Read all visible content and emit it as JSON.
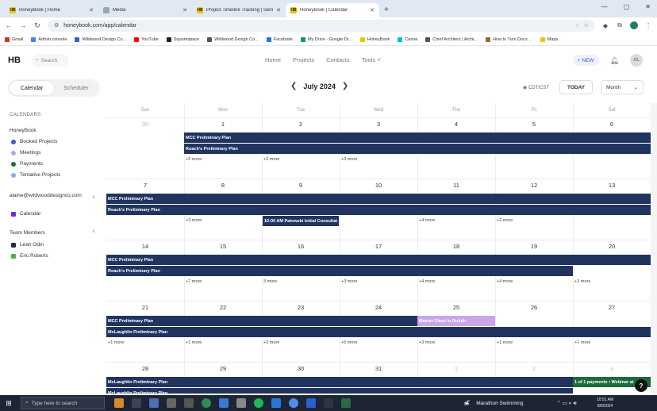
{
  "browser": {
    "tabs": [
      {
        "label": "HoneyBook | Home",
        "favicon": "HB"
      },
      {
        "label": "Media",
        "favicon": "media"
      },
      {
        "label": "Project Timeline Tracking | Semrau",
        "favicon": "HB"
      },
      {
        "label": "HoneyBook | Calendar",
        "favicon": "HB",
        "active": true
      }
    ],
    "url": "honeybook.com/app/calendar",
    "bookmarks": [
      "Gmail",
      "Admin console",
      "Wildwood Design Co...",
      "YouTube",
      "Squarespace",
      "Wildwood Design Co...",
      "Facebook",
      "My Drive - Google Dr...",
      "HoneyBook",
      "Canva",
      "Chief Architect | Archi...",
      "How to Turn Docs ...",
      "Maps"
    ]
  },
  "app": {
    "logo": "HB",
    "search_placeholder": "Search",
    "nav": [
      "Home",
      "Projects",
      "Contacts",
      "Tools ˅"
    ],
    "new_button": "+ NEW",
    "avatar_initials": "AL"
  },
  "toolbar": {
    "views": [
      "Calendar",
      "Scheduler"
    ],
    "month_label": "July 2024",
    "timezone": "CDT/CST",
    "today_label": "TODAY",
    "period_label": "Month"
  },
  "sidebar": {
    "title": "CALENDARS",
    "honeybook_group": "HoneyBook",
    "honeybook_items": [
      {
        "label": "Booked Projects",
        "color": "#3b5bd8"
      },
      {
        "label": "Meetings",
        "color": "#b9a4e6"
      },
      {
        "label": "Payments",
        "color": "#1d6b3d"
      },
      {
        "label": "Tentative Projects",
        "color": "#8fa9ee"
      }
    ],
    "account_email": "alaine@wildwooddesignco.com",
    "account_items": [
      {
        "label": "Calendar",
        "color": "#6f2bd9"
      }
    ],
    "team_group": "Team Members",
    "team_items": [
      {
        "label": "Leah Odin",
        "color": "#1f2d4d"
      },
      {
        "label": "Eric Roberts",
        "color": "#4caf50"
      }
    ]
  },
  "calendar": {
    "weekdays": [
      "Sun",
      "Mon",
      "Tue",
      "Wed",
      "Thu",
      "Fri",
      "Sat"
    ],
    "weeks": [
      {
        "days": [
          {
            "num": "30",
            "muted": true
          },
          {
            "num": "1"
          },
          {
            "num": "2"
          },
          {
            "num": "3"
          },
          {
            "num": "4"
          },
          {
            "num": "5"
          },
          {
            "num": "6"
          }
        ],
        "events": [
          {
            "label": "MCC Preliminary Plan",
            "start": 1,
            "span": 6,
            "lane": 0
          },
          {
            "label": "Roach's Preliminary Plan",
            "start": 1,
            "span": 6,
            "lane": 1
          }
        ],
        "more": [
          {
            "col": 1,
            "text": "+5 more"
          },
          {
            "col": 2,
            "text": "+3 more"
          },
          {
            "col": 3,
            "text": "+3 more"
          }
        ]
      },
      {
        "days": [
          {
            "num": "7"
          },
          {
            "num": "8"
          },
          {
            "num": "9"
          },
          {
            "num": "10"
          },
          {
            "num": "11"
          },
          {
            "num": "12"
          },
          {
            "num": "13"
          }
        ],
        "events": [
          {
            "label": "MCC Preliminary Plan",
            "start": 0,
            "span": 7,
            "lane": 0
          },
          {
            "label": "Roach's Preliminary Plan",
            "start": 0,
            "span": 7,
            "lane": 1
          },
          {
            "label": "10:00 AM Patowski Initial Consultat",
            "start": 2,
            "span": 1,
            "lane": 2,
            "cell": true
          }
        ],
        "more": [
          {
            "col": 1,
            "text": "+3 more"
          },
          {
            "col": 4,
            "text": "+4 more"
          },
          {
            "col": 5,
            "text": "+2 more"
          }
        ]
      },
      {
        "days": [
          {
            "num": "14"
          },
          {
            "num": "15"
          },
          {
            "num": "16"
          },
          {
            "num": "17"
          },
          {
            "num": "18"
          },
          {
            "num": "19"
          },
          {
            "num": "20"
          }
        ],
        "events": [
          {
            "label": "MCC Preliminary Plan",
            "start": 0,
            "span": 7,
            "lane": 0
          },
          {
            "label": "Roach's Preliminary Plan",
            "start": 0,
            "span": 6,
            "lane": 1
          }
        ],
        "more": [
          {
            "col": 1,
            "text": "+7 more"
          },
          {
            "col": 2,
            "text": "3 more"
          },
          {
            "col": 3,
            "text": "+3 more"
          },
          {
            "col": 4,
            "text": "+4 more"
          },
          {
            "col": 5,
            "text": "+4 more"
          },
          {
            "col": 6,
            "text": "+3 more"
          }
        ]
      },
      {
        "days": [
          {
            "num": "21"
          },
          {
            "num": "22"
          },
          {
            "num": "23"
          },
          {
            "num": "24"
          },
          {
            "num": "25"
          },
          {
            "num": "26"
          },
          {
            "num": "27"
          }
        ],
        "events": [
          {
            "label": "MCC Preliminary Plan",
            "start": 0,
            "span": 4,
            "lane": 0
          },
          {
            "label": "Master Class In Duluth",
            "start": 4,
            "span": 1,
            "lane": 0,
            "style": "pink"
          },
          {
            "label": "McLaughlin Preliminary Plan",
            "start": 0,
            "span": 7,
            "lane": 1
          }
        ],
        "more": [
          {
            "col": 0,
            "text": "+1 more"
          },
          {
            "col": 1,
            "text": "+1 more"
          },
          {
            "col": 2,
            "text": "+3 more"
          },
          {
            "col": 3,
            "text": "+5 more"
          },
          {
            "col": 4,
            "text": "+3 more"
          },
          {
            "col": 5,
            "text": "+1 more"
          },
          {
            "col": 6,
            "text": "+1 more"
          }
        ]
      },
      {
        "days": [
          {
            "num": "28"
          },
          {
            "num": "29"
          },
          {
            "num": "30"
          },
          {
            "num": "31"
          },
          {
            "num": "1",
            "muted": true
          },
          {
            "num": "2",
            "muted": true
          },
          {
            "num": "3",
            "muted": true
          }
        ],
        "events": [
          {
            "label": "McLaughlin Preliminary Plan",
            "start": 0,
            "span": 6,
            "lane": 0
          },
          {
            "label": "1 of 1 payments • Webinar at ...",
            "start": 6,
            "span": 1,
            "lane": 0,
            "style": "green"
          },
          {
            "label": "McLaughlin Preliminary Plan",
            "start": 0,
            "span": 6,
            "lane": 1
          }
        ],
        "more": []
      }
    ]
  },
  "taskbar": {
    "search_placeholder": "Type here to search",
    "weather": "Marathon Swimming",
    "time": "10:51 AM",
    "date": "8/6/2024"
  }
}
